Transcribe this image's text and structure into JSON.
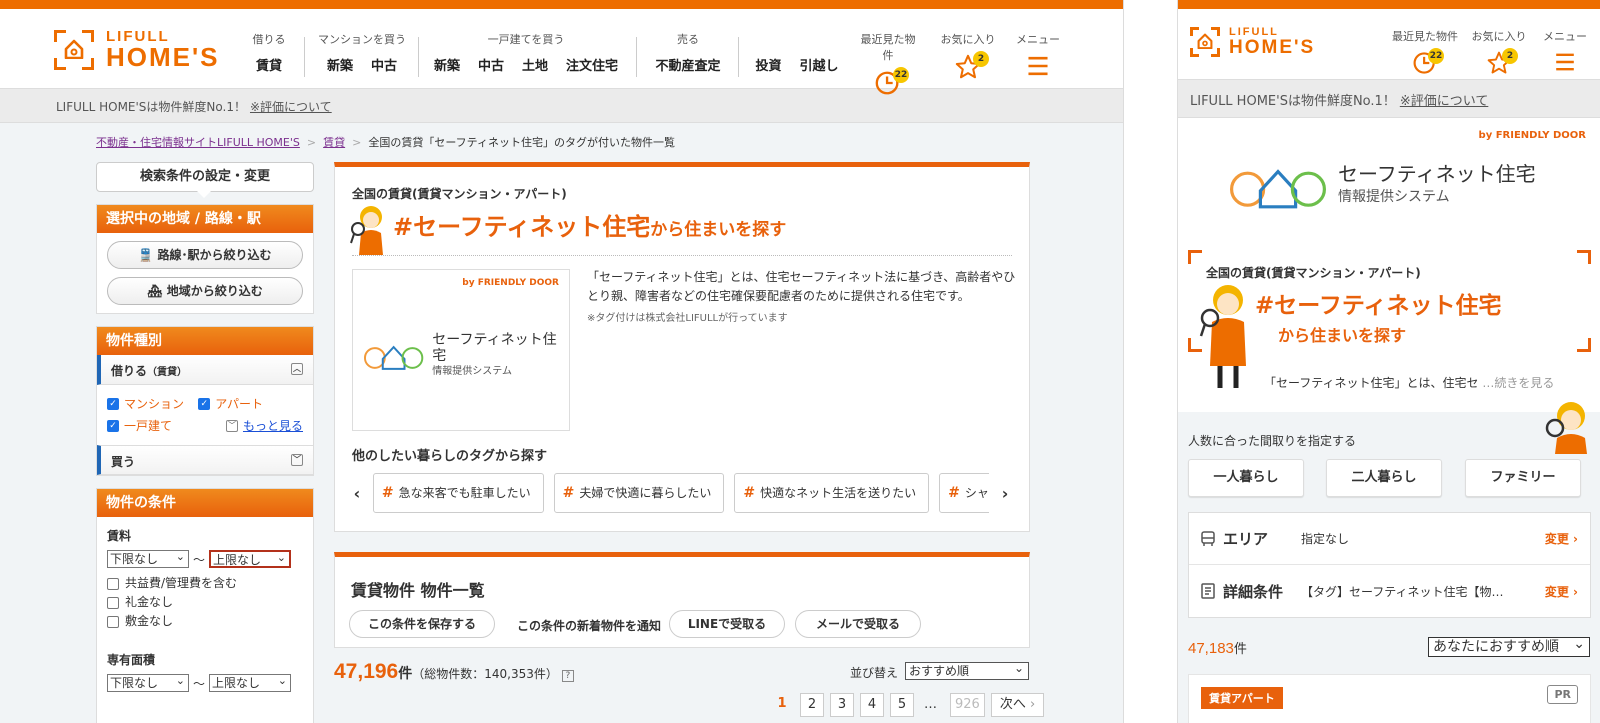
{
  "site": {
    "logo_line1": "LIFULL",
    "logo_line2": "HOME'S",
    "brand_color": "#ed6d00"
  },
  "nav": {
    "groups": [
      {
        "caption": "借りる",
        "links": [
          "賃貸"
        ]
      },
      {
        "caption": "マンションを買う",
        "links": [
          "新築",
          "中古"
        ]
      },
      {
        "caption": "一戸建てを買う",
        "links": [
          "新築",
          "中古",
          "土地",
          "注文住宅"
        ]
      },
      {
        "caption": "売る",
        "links": [
          "不動産査定"
        ]
      },
      {
        "caption": "",
        "links": [
          "投資",
          "引越し"
        ]
      }
    ],
    "recent_label": "最近見た物件",
    "recent_count": "22",
    "favorites_label": "お気に入り",
    "favorites_count": "2",
    "menu_label": "メニュー"
  },
  "fresh_bar": {
    "text": "LIFULL HOME'Sは物件鮮度No.1！",
    "link": "※評価について"
  },
  "breadcrumb": {
    "home": "不動産・住宅情報サイトLIFULL HOME'S",
    "rent": "賃貸",
    "current": "全国の賃貸「セーフティネット住宅」のタグが付いた物件一覧"
  },
  "sidebar": {
    "condition_button": "検索条件の設定・変更",
    "area_head": "選択中の地域 / 路線・駅",
    "route_button": "路線･駅から絞り込む",
    "area_button": "地域から絞り込む",
    "type_head": "物件種別",
    "rent_head": "借りる",
    "rent_sub": "（賃貸）",
    "check_mansion": "マンション",
    "check_apart": "アパート",
    "check_house": "一戸建て",
    "more": "もっと見る",
    "buy_head": "買う",
    "cond_head": "物件の条件",
    "rent_label": "賃料",
    "min_none": "下限なし",
    "max_none": "上限なし",
    "tilde": "〜",
    "opt_fee": "共益費/管理費を含む",
    "opt_reikin": "礼金なし",
    "opt_shikikin": "敷金なし",
    "area_label": "専有面積"
  },
  "tag_card": {
    "pre_title": "全国の賃貸(賃貸マンション・アパート)",
    "title_main": "#セーフティネット住宅",
    "title_suffix": "から住まいを探す",
    "by": "by FRIENDLY DOOR",
    "logo_name": "セーフティネット住宅",
    "logo_sub": "情報提供システム",
    "description": "「セーフティネット住宅」とは、住宅セーフティネット法に基づき、高齢者やひとり親、障害者などの住宅確保要配慮者のために提供される住宅です。",
    "note": "※タグ付けは株式会社LIFULLが行っています",
    "other_tags_title": "他のしたい暮らしのタグから探す",
    "tags": [
      "急な来客でも駐車したい",
      "夫婦で快適に暮らしたい",
      "快適なネット生活を送りたい",
      "シャー…"
    ]
  },
  "list_card": {
    "title": "賃貸物件 物件一覧",
    "save_button": "この条件を保存する",
    "notify_label": "この条件の新着物件を通知",
    "line_button": "LINEで受取る",
    "mail_button": "メールで受取る"
  },
  "results": {
    "count": "47,196",
    "unit": "件",
    "total": "（総物件数：140,353件）",
    "sort_label": "並び替え",
    "sort_value": "おすすめ順",
    "pages": [
      "1",
      "2",
      "3",
      "4",
      "5"
    ],
    "ellipsis": "…",
    "last_page": "926",
    "next": "次へ"
  },
  "mobile": {
    "fresh_text": "LIFULL HOME'Sは物件鮮度No.1！",
    "fresh_link": "※評価について",
    "hero_pre": "全国の賃貸(賃貸マンション・アパート)",
    "hero_title": "#セーフティネット住宅",
    "hero_sub": "から住まいを探す",
    "hero_text": "「セーフティネット住宅」とは、住宅セ",
    "hero_more": "…続きを見る",
    "layout_title": "人数に合った間取りを指定する",
    "btn_single": "一人暮らし",
    "btn_couple": "二人暮らし",
    "btn_family": "ファミリー",
    "area_key": "エリア",
    "area_val": "指定なし",
    "detail_key": "詳細条件",
    "detail_val": "【タグ】セーフティネット住宅【物…",
    "change": "変更",
    "count": "47,183",
    "unit": "件",
    "sort_value": "あなたにおすすめ順",
    "card_label": "賃貸アパート",
    "pr": "PR"
  }
}
